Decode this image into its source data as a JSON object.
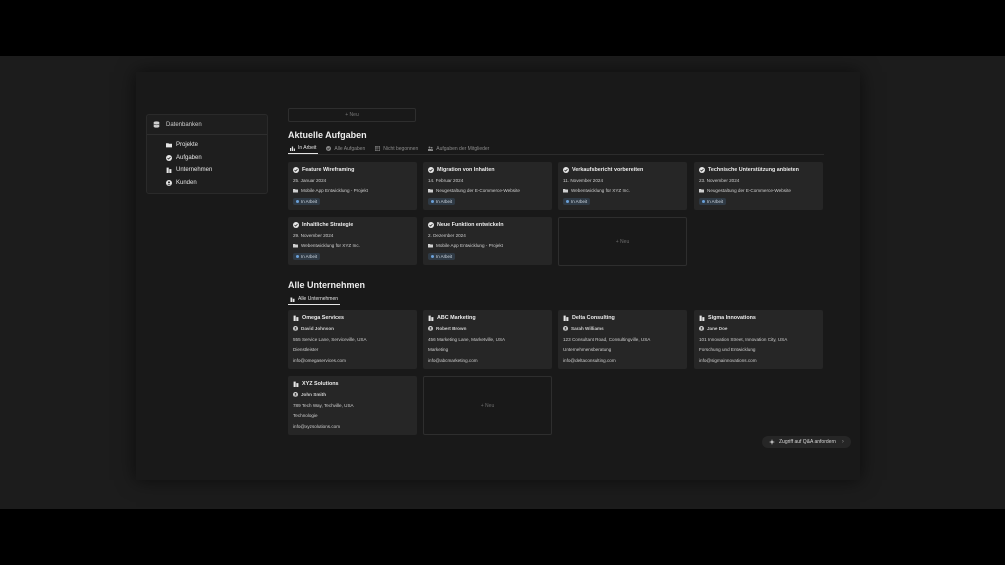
{
  "sidebar": {
    "header": "Datenbanken",
    "items": [
      {
        "label": "Projekte"
      },
      {
        "label": "Aufgaben"
      },
      {
        "label": "Unternehmen"
      },
      {
        "label": "Kunden"
      }
    ]
  },
  "new_label": "Neu",
  "new_label_plus": "+ Neu",
  "tasks": {
    "title": "Aktuelle Aufgaben",
    "tabs": [
      "In Arbeit",
      "Alle Aufgaben",
      "Nicht begonnen",
      "Aufgaben der Mitglieder"
    ],
    "cards": [
      {
        "title": "Feature Wireframing",
        "date": "25. Januar 2024",
        "project": "Mobile App Entwicklung - Projekt",
        "status": "In Arbeit"
      },
      {
        "title": "Migration von Inhalten",
        "date": "14. Februar 2024",
        "project": "Neugestaltung der E-Commerce-Website",
        "status": "In Arbeit"
      },
      {
        "title": "Verkaufsbericht vorbereiten",
        "date": "11. November 2024",
        "project": "Webentwicklung für XYZ Inc.",
        "status": "In Arbeit"
      },
      {
        "title": "Technische Unterstützung anbieten",
        "date": "23. November 2024",
        "project": "Neugestaltung der E-Commerce-Website",
        "status": "In Arbeit"
      },
      {
        "title": "Inhaltliche Strategie",
        "date": "29. November 2024",
        "project": "Webentwicklung für XYZ Inc.",
        "status": "In Arbeit"
      },
      {
        "title": "Neue Funktion entwickeln",
        "date": "2. Dezember 2024",
        "project": "Mobile App Entwicklung - Projekt",
        "status": "In Arbeit"
      }
    ]
  },
  "companies": {
    "title": "Alle Unternehmen",
    "tabs": [
      "Alle Unternehmen"
    ],
    "cards": [
      {
        "name": "Omega Services",
        "contact": "David Johnson",
        "address": "555 Service Lane, Serviceville, USA",
        "industry": "Dienstleister",
        "email": "info@omegaservices.com"
      },
      {
        "name": "ABC Marketing",
        "contact": "Robert Brown",
        "address": "456 Marketing Lane, Marketville, USA",
        "industry": "Marketing",
        "email": "info@abcmarketing.com"
      },
      {
        "name": "Delta Consulting",
        "contact": "Sarah Williams",
        "address": "123 Consultant Road, Consultingville, USA",
        "industry": "Unternehmensberatung",
        "email": "info@deltaconsulting.com"
      },
      {
        "name": "Sigma Innovations",
        "contact": "Jane Doe",
        "address": "101 Innovation Street, Innovation City, USA",
        "industry": "Forschung und Entwicklung",
        "email": "info@sigmainnovations.com"
      },
      {
        "name": "XYZ Solutions",
        "contact": "John Smith",
        "address": "789 Tech Way, Techville, USA",
        "industry": "Technologie",
        "email": "info@xyzsolutions.com"
      }
    ]
  },
  "qa_button": "Zugriff auf Q&A anfordern"
}
